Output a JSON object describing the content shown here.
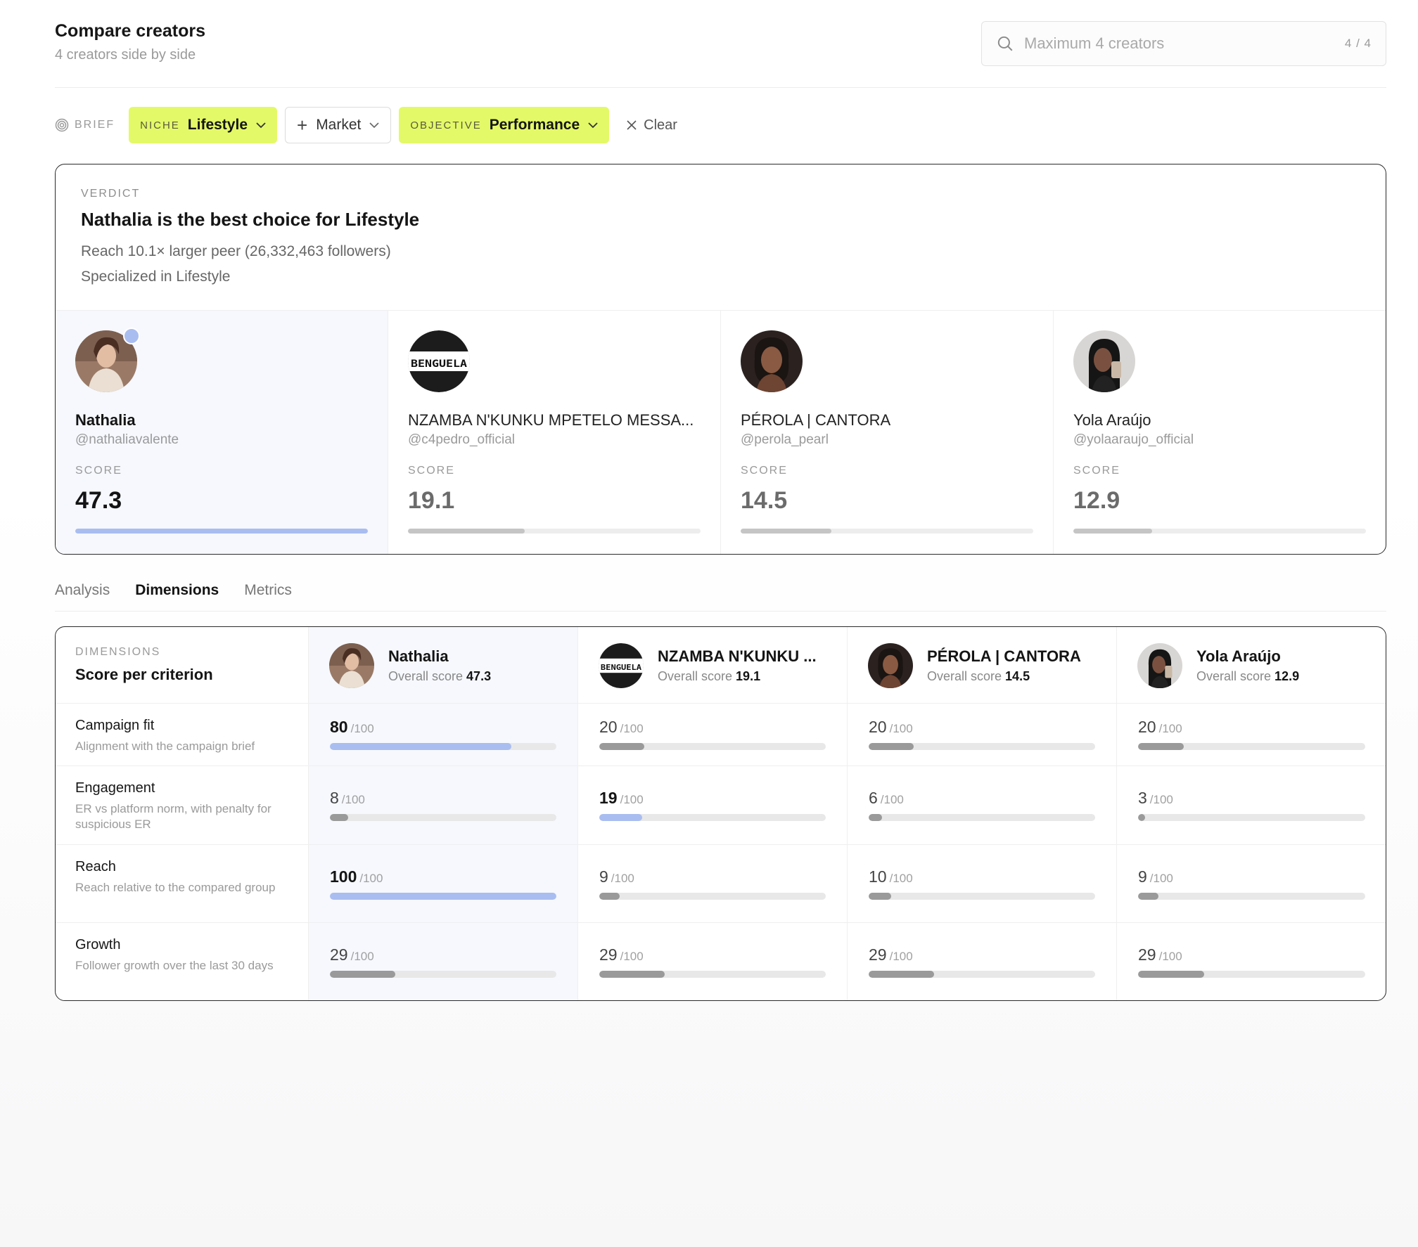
{
  "header": {
    "title": "Compare creators",
    "subtitle": "4 creators side by side",
    "search_placeholder": "Maximum 4 creators",
    "search_count": "4 / 4"
  },
  "brief": {
    "label": "BRIEF",
    "niche_key": "NICHE",
    "niche_value": "Lifestyle",
    "market_label": "Market",
    "objective_key": "OBJECTIVE",
    "objective_value": "Performance",
    "clear_label": "Clear"
  },
  "colors": {
    "accent_chip": "#e4f968",
    "best_highlight": "#a9bdf0",
    "bar_default": "#9a9a9a"
  },
  "verdict": {
    "label": "VERDICT",
    "title": "Nathalia is the best choice for Lifestyle",
    "reason_1": "Reach 10.1× larger peer (26,332,463 followers)",
    "reason_2": "Specialized in Lifestyle"
  },
  "creators": [
    {
      "name": "Nathalia",
      "short_name": "Nathalia",
      "handle": "@nathaliavalente",
      "score_label": "SCORE",
      "score": "47.3",
      "score_fraction": 1.0,
      "overall_label": "Overall score",
      "avatar": "portrait-woman-icon"
    },
    {
      "name": "NZAMBA N'KUNKU MPETELO MESSA...",
      "short_name": "NZAMBA N'KUNKU ...",
      "handle": "@c4pedro_official",
      "score_label": "SCORE",
      "score": "19.1",
      "score_fraction": 0.4,
      "overall_label": "Overall score",
      "avatar": "benguela-logo",
      "logo_text": "BENGUELA"
    },
    {
      "name": "PÉROLA | CANTORA",
      "short_name": "PÉROLA | CANTORA",
      "handle": "@perola_pearl",
      "score_label": "SCORE",
      "score": "14.5",
      "score_fraction": 0.31,
      "overall_label": "Overall score",
      "avatar": "portrait-woman-icon"
    },
    {
      "name": "Yola Araújo",
      "short_name": "Yola Araújo",
      "handle": "@yolaaraujo_official",
      "score_label": "SCORE",
      "score": "12.9",
      "score_fraction": 0.27,
      "overall_label": "Overall score",
      "avatar": "portrait-woman-phone-icon"
    }
  ],
  "tabs": [
    {
      "label": "Analysis",
      "active": false
    },
    {
      "label": "Dimensions",
      "active": true
    },
    {
      "label": "Metrics",
      "active": false
    }
  ],
  "dimensions": {
    "label": "DIMENSIONS",
    "title": "Score per criterion",
    "max_label": "/100",
    "criteria": [
      {
        "name": "Campaign fit",
        "description": "Alignment with the campaign brief",
        "scores": [
          80,
          20,
          20,
          20
        ],
        "best_index": 0
      },
      {
        "name": "Engagement",
        "description": "ER vs platform norm, with penalty for suspicious ER",
        "scores": [
          8,
          19,
          6,
          3
        ],
        "best_index": 1
      },
      {
        "name": "Reach",
        "description": "Reach relative to the compared group",
        "scores": [
          100,
          9,
          10,
          9
        ],
        "best_index": 0
      },
      {
        "name": "Growth",
        "description": "Follower growth over the last 30 days",
        "scores": [
          29,
          29,
          29,
          29
        ],
        "best_index": -1
      }
    ]
  }
}
